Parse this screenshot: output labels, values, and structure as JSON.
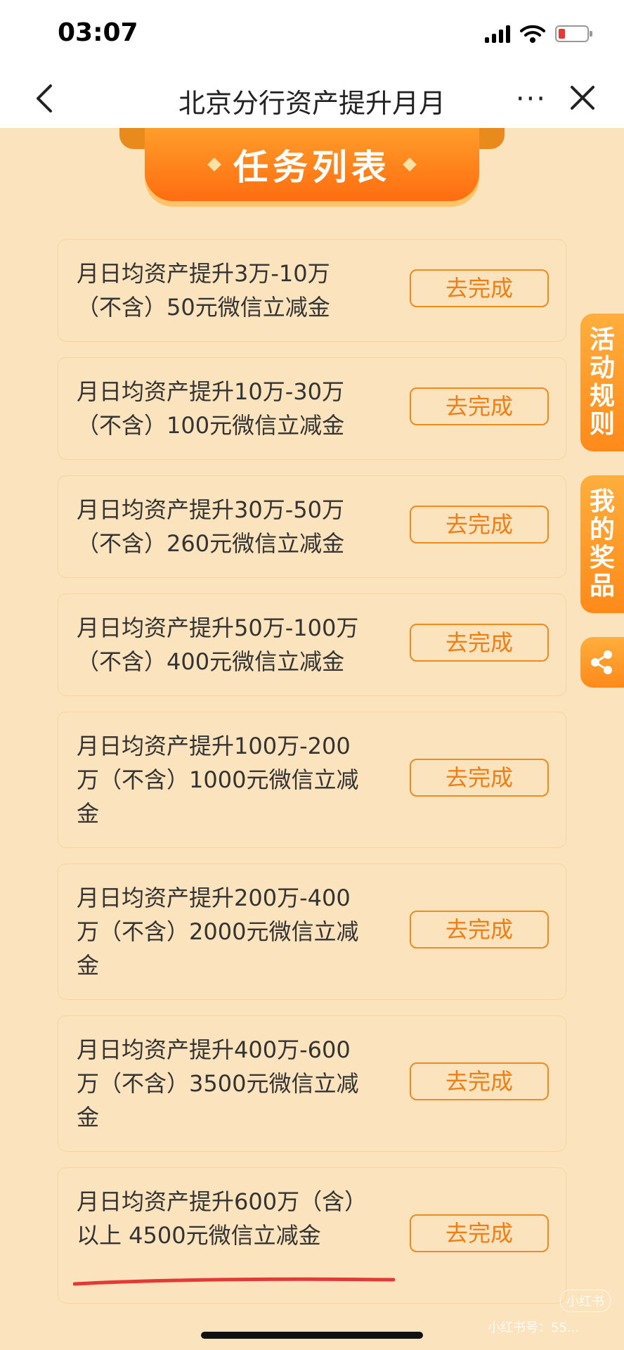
{
  "status": {
    "time": "03:07",
    "icons": [
      "signal-icon",
      "wifi-icon",
      "battery-low-icon"
    ]
  },
  "nav": {
    "title": "北京分行资产提升月月",
    "more": "···",
    "icons": [
      "back-icon",
      "more-icon",
      "close-icon"
    ]
  },
  "banner": {
    "title": "任务列表"
  },
  "tasks": [
    {
      "text": "月日均资产提升3万-10万（不含）50元微信立减金",
      "button": "去完成"
    },
    {
      "text": "月日均资产提升10万-30万（不含）100元微信立减金",
      "button": "去完成"
    },
    {
      "text": "月日均资产提升30万-50万（不含）260元微信立减金",
      "button": "去完成"
    },
    {
      "text": "月日均资产提升50万-100万（不含）400元微信立减金",
      "button": "去完成"
    },
    {
      "text": "月日均资产提升100万-200万（不含）1000元微信立减金",
      "button": "去完成"
    },
    {
      "text": "月日均资产提升200万-400万（不含）2000元微信立减金",
      "button": "去完成"
    },
    {
      "text": "月日均资产提升400万-600万（不含）3500元微信立减金",
      "button": "去完成"
    },
    {
      "text": "月日均资产提升600万（含）以上 4500元微信立减金",
      "button": "去完成"
    }
  ],
  "side": {
    "rules": [
      "活",
      "动",
      "规",
      "则"
    ],
    "prizes": [
      "我",
      "的",
      "奖",
      "品"
    ],
    "share_icon": "share-icon"
  },
  "colors": {
    "accent": "#f08a1e",
    "background": "#fbe3bd",
    "annotation": "#e53935"
  },
  "watermark": {
    "logo": "小红书",
    "text": "小红书号：55..."
  }
}
